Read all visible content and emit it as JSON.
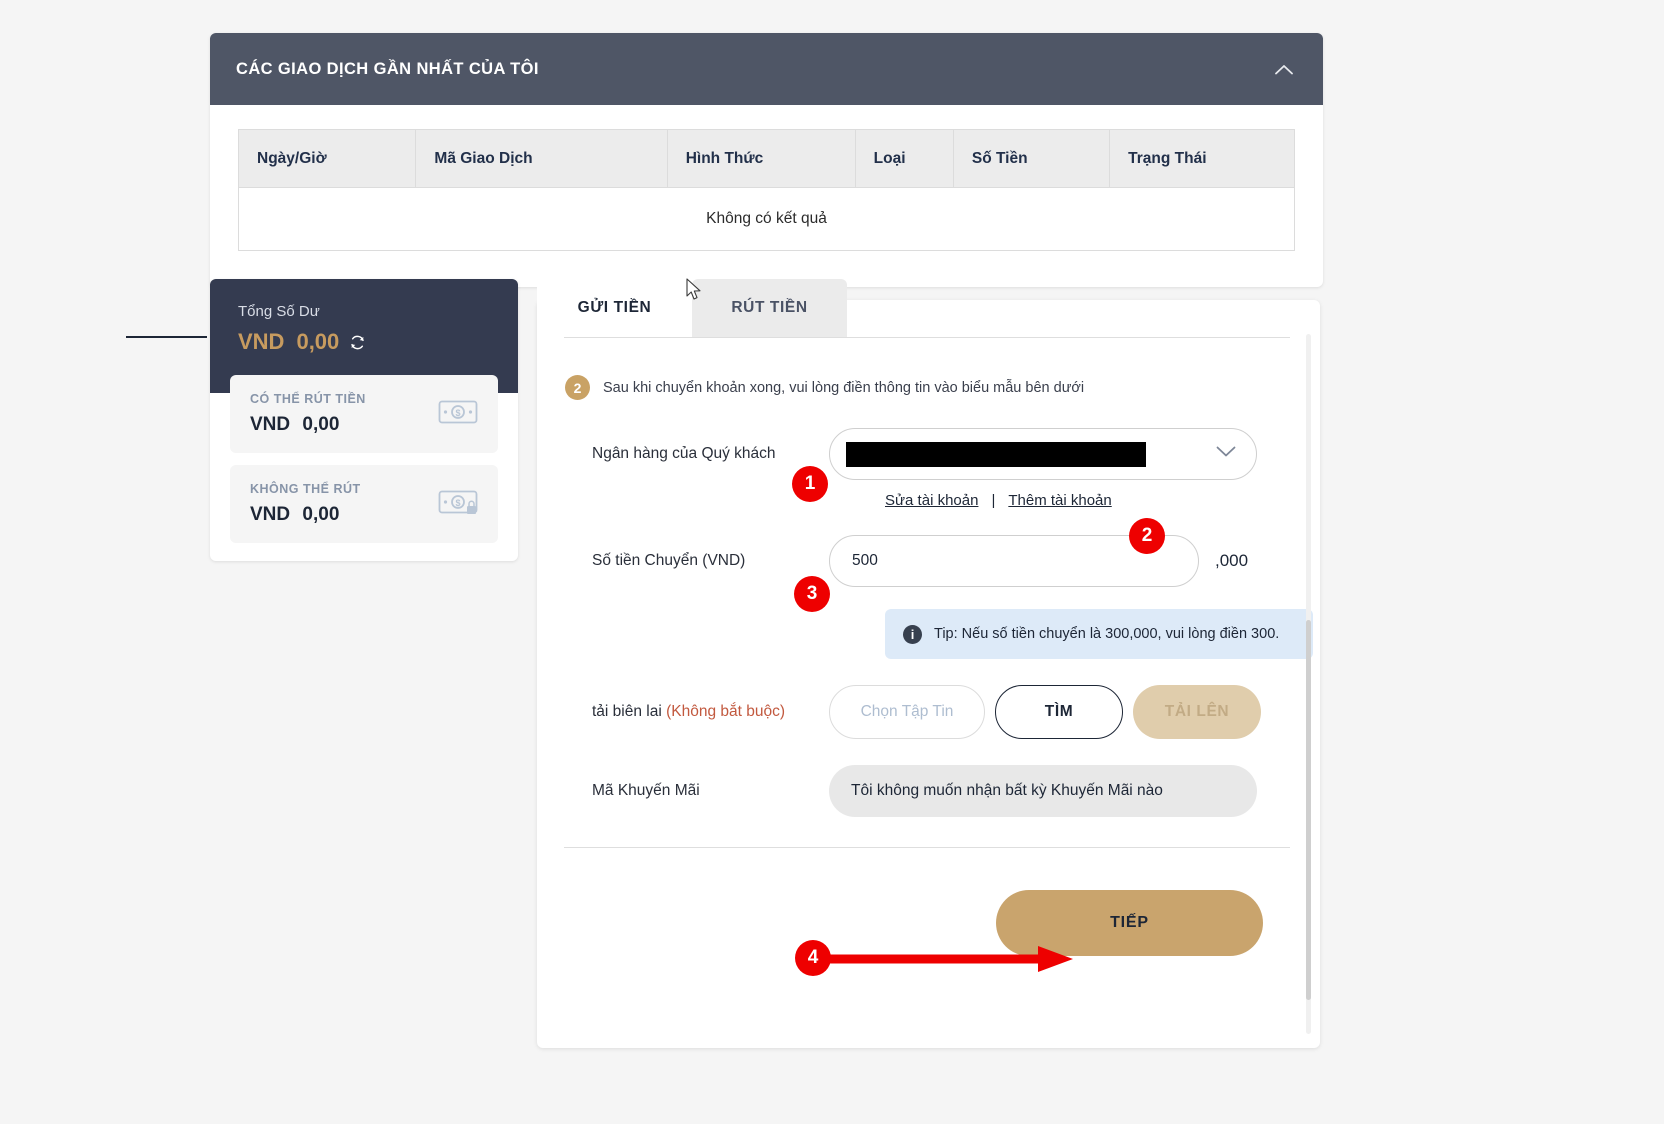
{
  "transactions_card": {
    "title": "CÁC GIAO DỊCH GẦN NHẤT CỦA TÔI",
    "collapse_icon": "chevron-up-icon",
    "columns": [
      "Ngày/Giờ",
      "Mã Giao Dịch",
      "Hình Thức",
      "Loại",
      "Số Tiền",
      "Trạng Thái"
    ],
    "empty_message": "Không có kết quả"
  },
  "balance": {
    "total_label": "Tổng Số Dư",
    "total_currency": "VND",
    "total_amount": "0,00",
    "refresh_icon": "refresh-icon",
    "items": [
      {
        "label": "CÓ THỂ RÚT TIỀN",
        "currency": "VND",
        "amount": "0,00",
        "icon": "banknote-icon"
      },
      {
        "label": "KHÔNG THỂ RÚT",
        "currency": "VND",
        "amount": "0,00",
        "icon": "banknote-lock-icon"
      }
    ]
  },
  "tabs": [
    {
      "label": "GỬI TIỀN",
      "active": true
    },
    {
      "label": "RÚT TIỀN",
      "active": false
    }
  ],
  "form": {
    "step_number": "2",
    "step_text": "Sau khi chuyển khoản xong, vui lòng điền thông tin vào biểu mẫu bên dưới",
    "bank_label": "Ngân hàng của Quý khách",
    "bank_value": "",
    "bank_chevron_icon": "chevron-down-icon",
    "edit_account_link": "Sửa tài khoản",
    "link_separator": "|",
    "add_account_link": "Thêm tài khoản",
    "amount_label": "Số tiền Chuyển (VND)",
    "amount_value": "500",
    "amount_suffix": ",000",
    "tip_icon": "info-icon",
    "tip_text": "Tip: Nếu số tiền chuyển là 300,000, vui lòng điền 300.",
    "receipt_label": "tải biên lai",
    "receipt_optional": "(Không bắt buộc)",
    "choose_file_label": "Chọn Tập Tin",
    "find_label": "TÌM",
    "upload_label": "TẢI LÊN",
    "promo_label": "Mã Khuyến Mãi",
    "promo_value": "Tôi không muốn nhận bất kỳ Khuyến Mãi nào",
    "submit_label": "TIẾP"
  },
  "annotations": {
    "marker_1": "1",
    "marker_2": "2",
    "marker_3": "3",
    "marker_4": "4",
    "color": "#ee0000"
  },
  "colors": {
    "header_bg": "#4f5666",
    "sidebar_bg": "#343b50",
    "accent_gold": "#c9a46d",
    "tip_bg": "#ddeaf8",
    "marker_red": "#ee0000"
  }
}
